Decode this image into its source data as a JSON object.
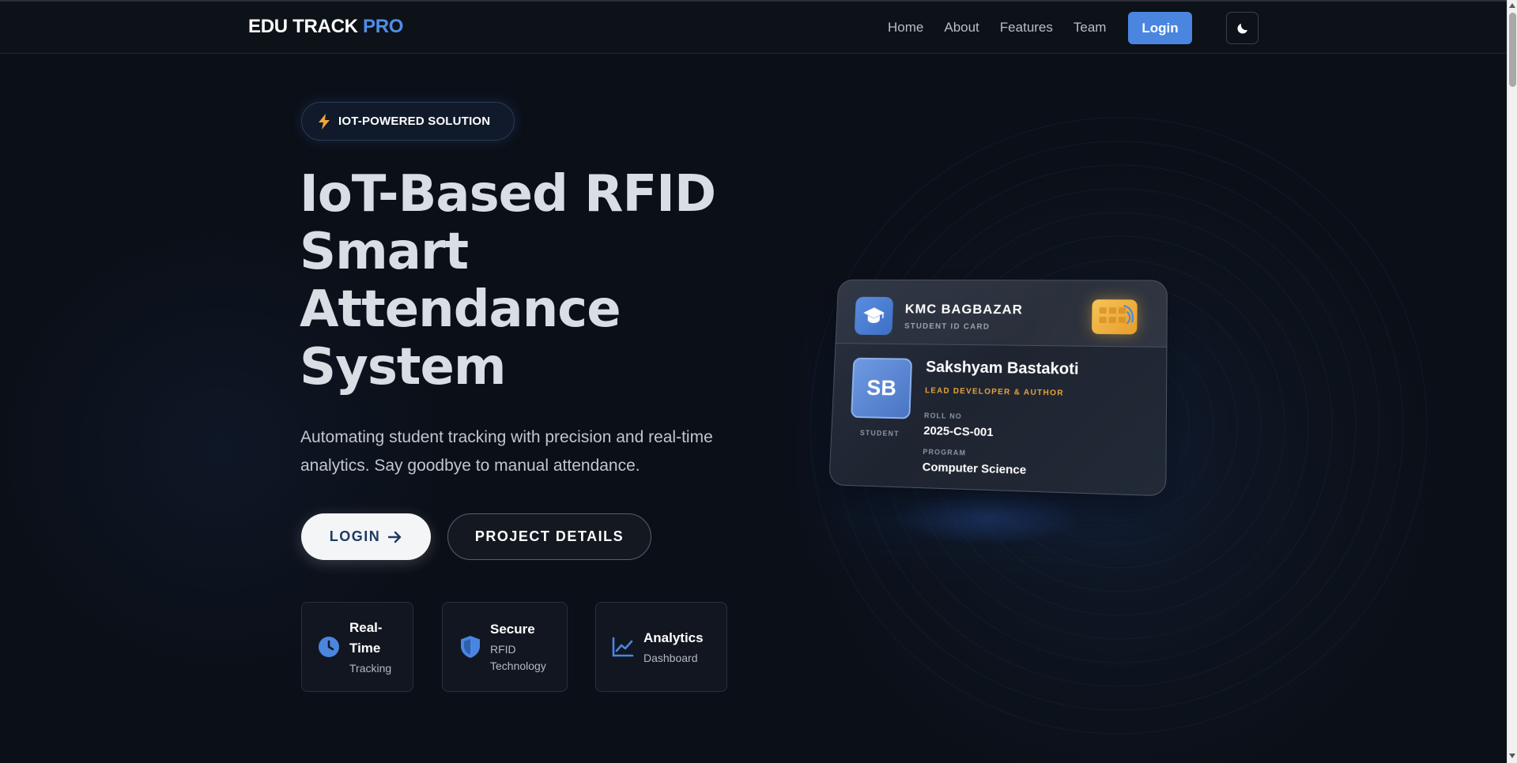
{
  "nav": {
    "brand_main": "EDU TRACK",
    "brand_accent": "PRO",
    "links": [
      "Home",
      "About",
      "Features",
      "Team"
    ],
    "login_label": "Login"
  },
  "hero": {
    "badge_icon": "lightning-icon",
    "badge_label": "IOT-POWERED SOLUTION",
    "title": "IoT-Based RFID Smart Attendance System",
    "subtitle": "Automating student tracking with precision and real-time analytics. Say goodbye to manual attendance.",
    "primary_button": "LOGIN",
    "secondary_button": "PROJECT DETAILS"
  },
  "features": [
    {
      "icon": "clock-icon",
      "title": "Real-Time",
      "subtitle": "Tracking"
    },
    {
      "icon": "shield-icon",
      "title": "Secure",
      "subtitle": "RFID Technology"
    },
    {
      "icon": "chart-line-icon",
      "title": "Analytics",
      "subtitle": "Dashboard"
    }
  ],
  "card": {
    "org": "KMC BAGBAZAR",
    "type": "STUDENT ID CARD",
    "initials": "SB",
    "avatar_label": "STUDENT",
    "name": "Sakshyam Bastakoti",
    "role": "LEAD DEVELOPER & AUTHOR",
    "roll_label": "ROLL NO",
    "roll_value": "2025-CS-001",
    "program_label": "PROGRAM",
    "program_value": "Computer Science"
  },
  "colors": {
    "accent": "#4a86e0",
    "background": "#0b0f17",
    "chip": "#f6c456",
    "role": "#e8a53c"
  }
}
